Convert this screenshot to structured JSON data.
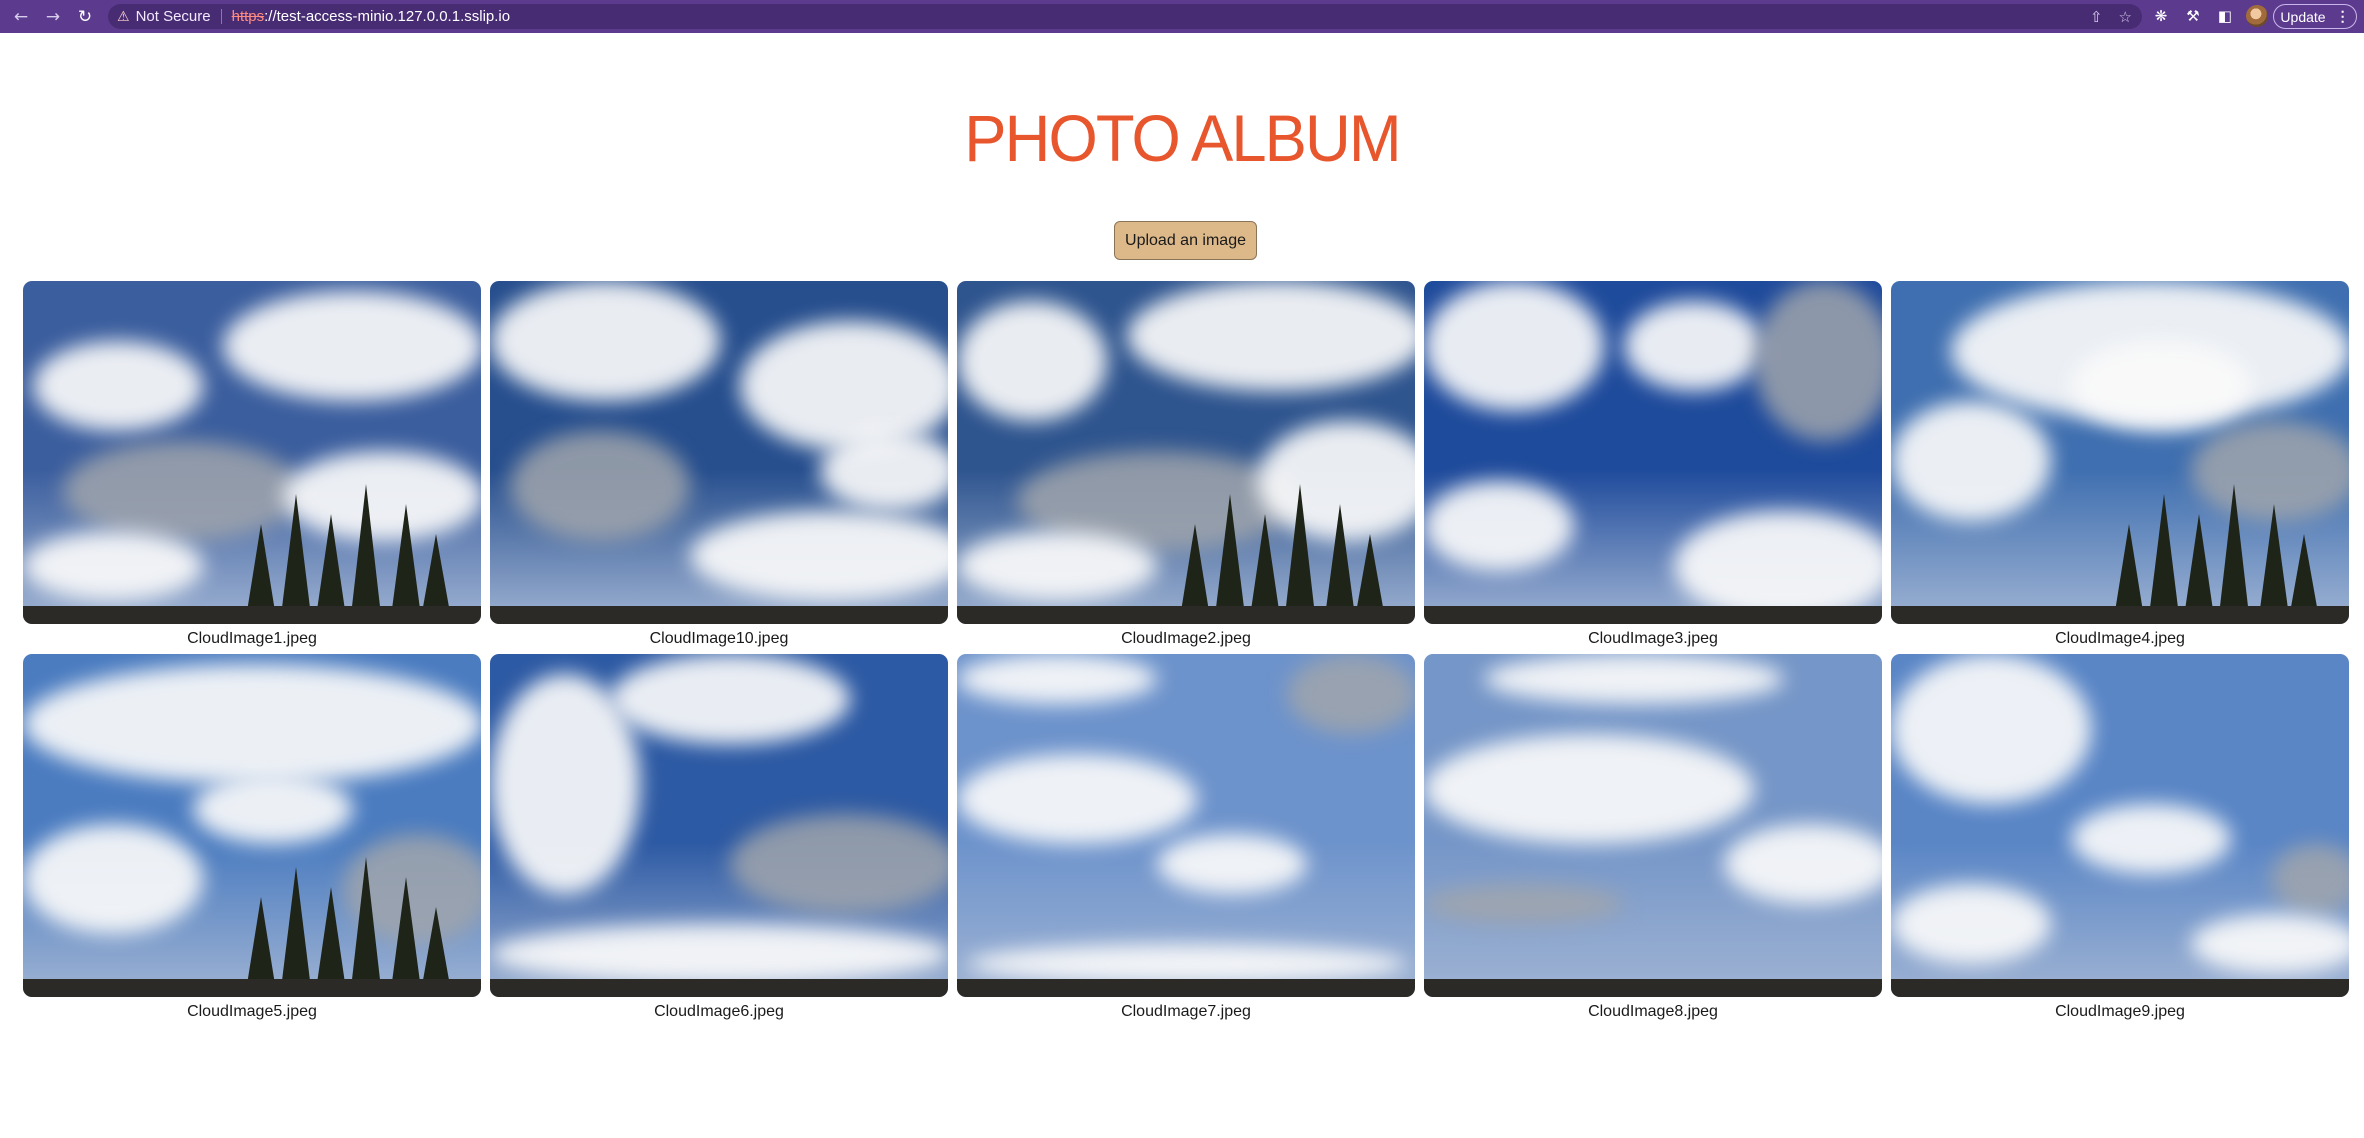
{
  "browser": {
    "security_label": "Not Secure",
    "url_scheme": "https",
    "url_rest": "://test-access-minio.127.0.0.1.sslip.io",
    "update_label": "Update"
  },
  "page": {
    "title": "PHOTO ALBUM",
    "upload_label": "Upload an image"
  },
  "photos": [
    {
      "name": "CloudImage1.jpeg",
      "sky": "#3b5e9e",
      "trees": true
    },
    {
      "name": "CloudImage10.jpeg",
      "sky": "#274f8e",
      "trees": false
    },
    {
      "name": "CloudImage2.jpeg",
      "sky": "#2f558f",
      "trees": true
    },
    {
      "name": "CloudImage3.jpeg",
      "sky": "#1f4b9c",
      "trees": false
    },
    {
      "name": "CloudImage4.jpeg",
      "sky": "#3f6fb0",
      "trees": true
    },
    {
      "name": "CloudImage5.jpeg",
      "sky": "#4b7cc0",
      "trees": true
    },
    {
      "name": "CloudImage6.jpeg",
      "sky": "#2d5aa4",
      "trees": false
    },
    {
      "name": "CloudImage7.jpeg",
      "sky": "#6d93cc",
      "trees": false
    },
    {
      "name": "CloudImage8.jpeg",
      "sky": "#7596c8",
      "trees": false
    },
    {
      "name": "CloudImage9.jpeg",
      "sky": "#5a86c6",
      "trees": false
    }
  ],
  "colors": {
    "title": "#e8562e",
    "upload_button": "#ddb98a",
    "browser_frame": "#5c3b8f"
  },
  "icons": {
    "back": "back-arrow-icon",
    "forward": "forward-arrow-icon",
    "reload": "reload-icon",
    "warning": "warning-triangle-icon",
    "share": "share-icon",
    "bookmark": "star-icon",
    "extension1": "chatgpt-extension-icon",
    "extensions": "puzzle-piece-icon",
    "sidebar": "side-panel-icon",
    "menu": "kebab-menu-icon"
  }
}
